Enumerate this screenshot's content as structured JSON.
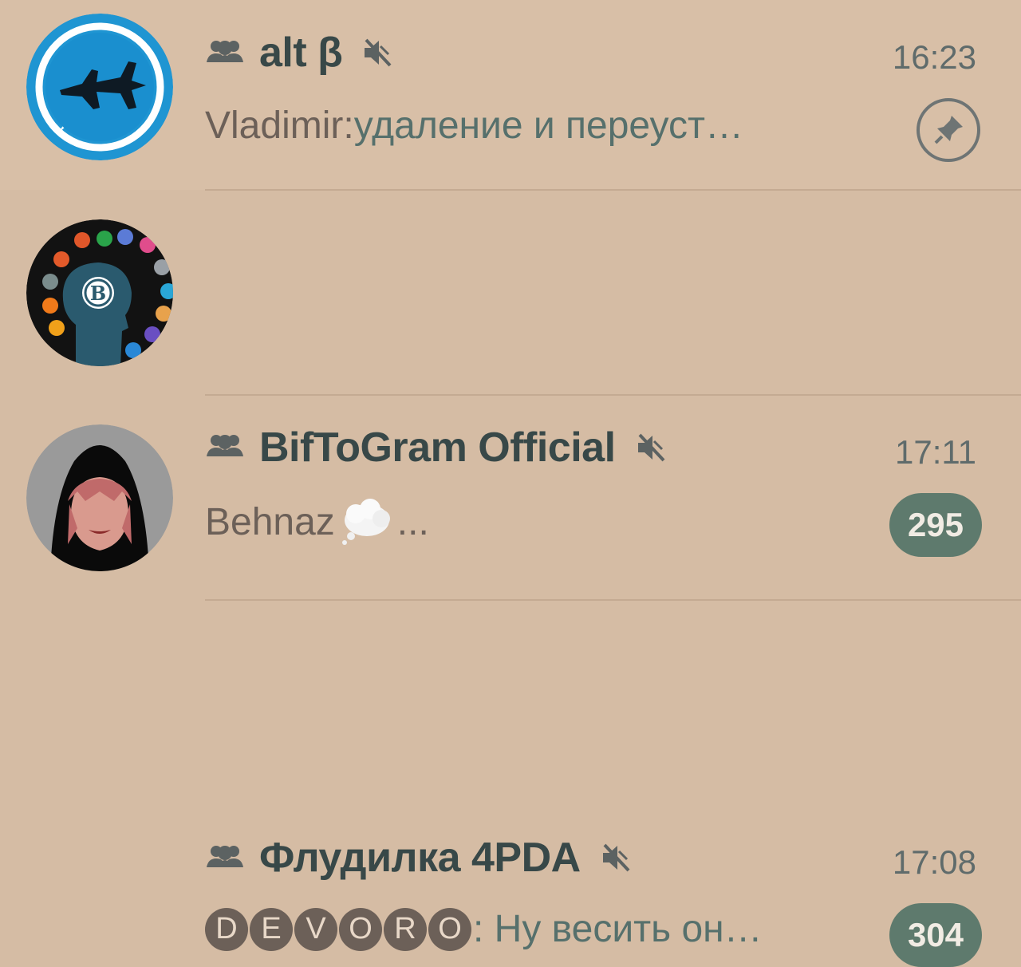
{
  "chats": [
    {
      "title": "alt β",
      "time": "16:23",
      "sender": "Vladimir:",
      "message": " удаление и переуст…",
      "indicator": "pin-icon"
    },
    {
      "title": "BifToGram Official",
      "time": "17:11",
      "sender": "Behnaz",
      "message": "...",
      "unread": "295"
    },
    {
      "title": "Флудилка 4PDA",
      "time": "17:08",
      "sender_letters": [
        "D",
        "E",
        "V",
        "O",
        "R",
        "O"
      ],
      "message": ": Ну весить он…",
      "unread": "304"
    }
  ],
  "icons": {
    "group": "group-icon",
    "mute": "mute-icon",
    "pin": "pin-icon"
  },
  "colors": {
    "background": "#d5bca4",
    "badge": "#5e7a6d",
    "avatar_blue": "#1f95d2"
  }
}
